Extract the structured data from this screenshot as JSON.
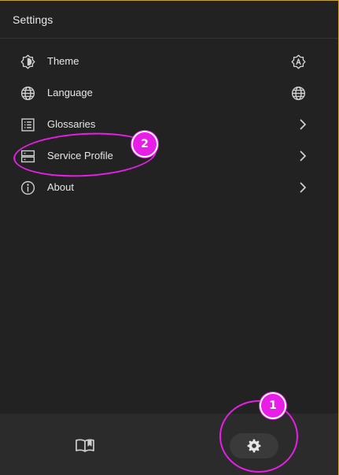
{
  "header": {
    "title": "Settings"
  },
  "menu": {
    "items": [
      {
        "label": "Theme",
        "icon": "theme-contrast-icon",
        "trailing": "auto-theme-icon"
      },
      {
        "label": "Language",
        "icon": "globe-icon",
        "trailing": "globe-icon"
      },
      {
        "label": "Glossaries",
        "icon": "list-box-icon",
        "trailing": "chevron-right-icon"
      },
      {
        "label": "Service Profile",
        "icon": "server-icon",
        "trailing": "chevron-right-icon"
      },
      {
        "label": "About",
        "icon": "info-icon",
        "trailing": "chevron-right-icon"
      }
    ]
  },
  "footer": {
    "nav": [
      {
        "name": "read-book-icon",
        "active": false
      },
      {
        "name": "gear-icon",
        "active": true
      }
    ]
  },
  "annotations": [
    {
      "number": "1",
      "target": "settings-nav-button"
    },
    {
      "number": "2",
      "target": "service-profile-item"
    }
  ],
  "colors": {
    "background": "#222222",
    "footer": "#2b2b2b",
    "text": "#e6e6e6",
    "annotation": "#e81ee8",
    "border_accent": "#c9a22a"
  }
}
